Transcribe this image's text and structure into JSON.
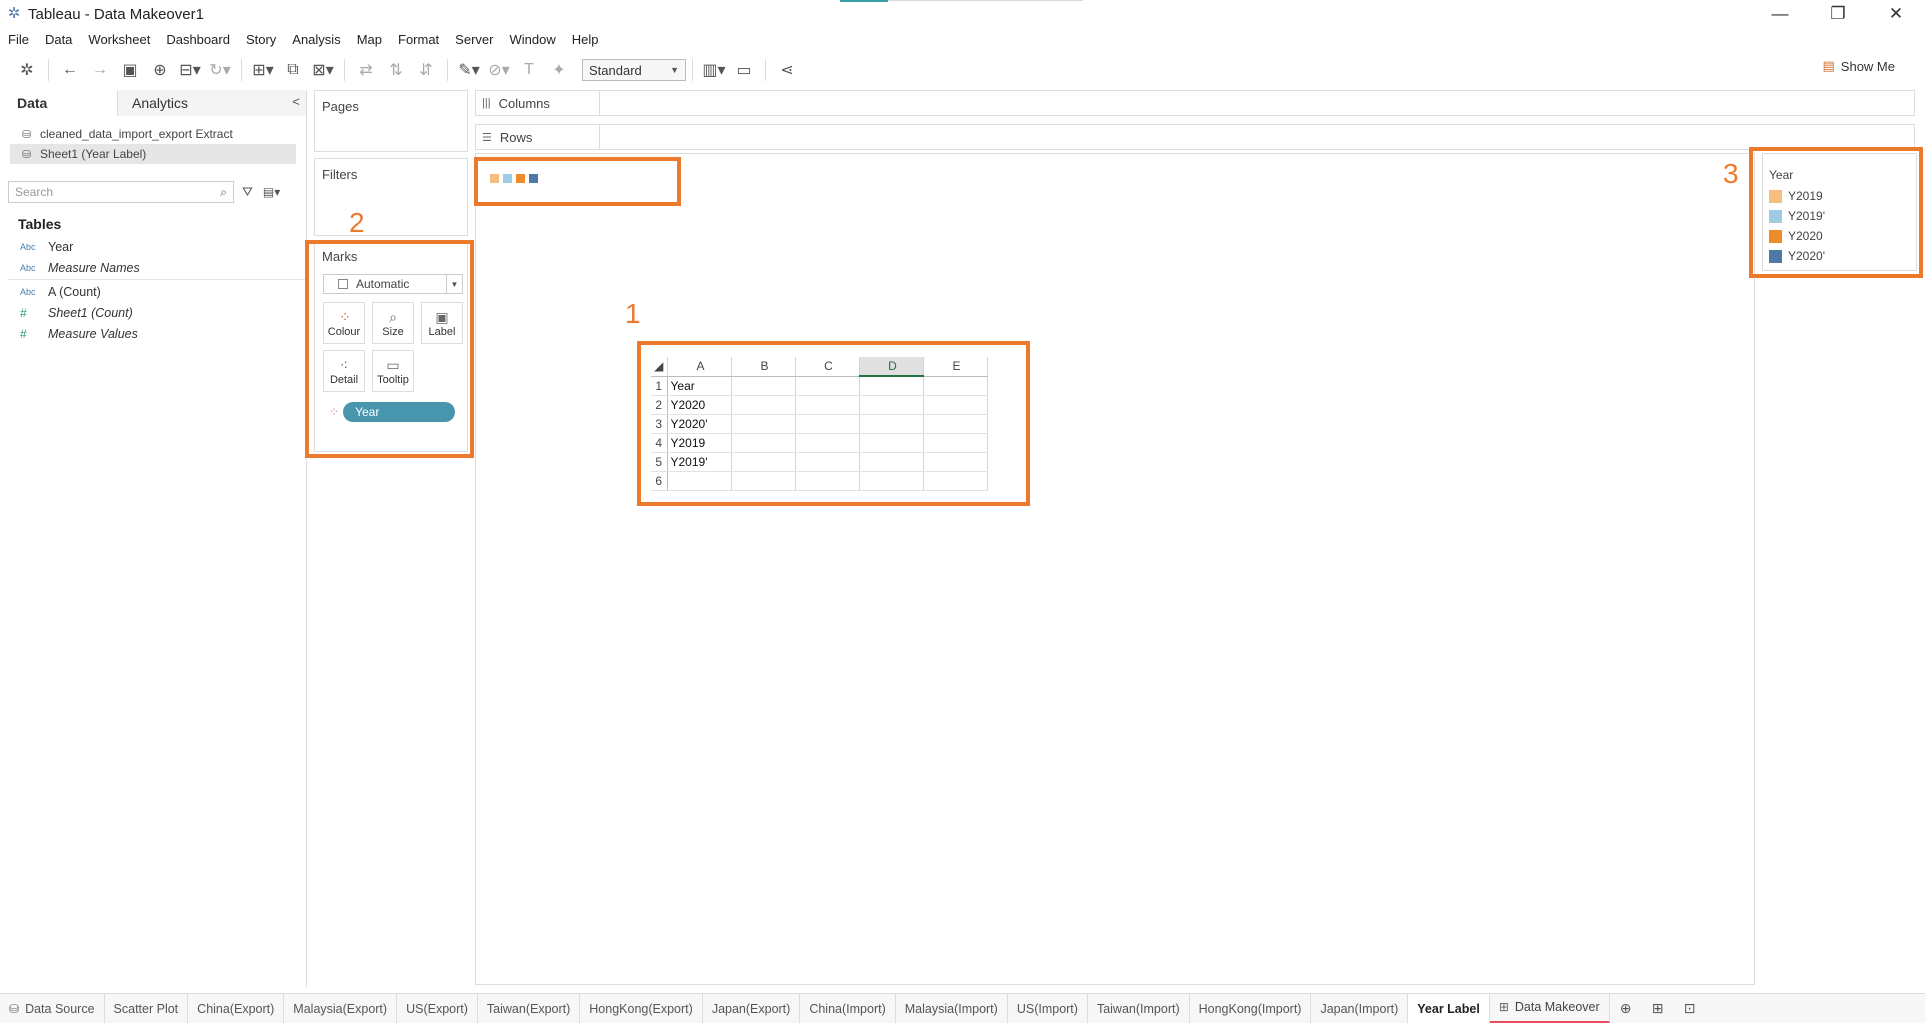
{
  "window": {
    "title": "Tableau - Data Makeover1",
    "controls": [
      "minimize",
      "restore",
      "close"
    ]
  },
  "menu": [
    "File",
    "Data",
    "Worksheet",
    "Dashboard",
    "Story",
    "Analysis",
    "Map",
    "Format",
    "Server",
    "Window",
    "Help"
  ],
  "toolbar": {
    "fit_select": "Standard",
    "show_me": "Show Me"
  },
  "data_pane": {
    "tabs": [
      "Data",
      "Analytics"
    ],
    "datasources": [
      "cleaned_data_import_export Extract",
      "Sheet1 (Year Label)"
    ],
    "search_placeholder": "Search",
    "tables_label": "Tables",
    "fields": [
      {
        "type": "Abc",
        "name": "Year",
        "italic": false
      },
      {
        "type": "Abc",
        "name": "Measure Names",
        "italic": true
      },
      {
        "type": "Abc",
        "name": "A (Count)",
        "italic": false
      },
      {
        "type": "#",
        "name": "Sheet1 (Count)",
        "italic": true
      },
      {
        "type": "#",
        "name": "Measure Values",
        "italic": true
      }
    ]
  },
  "shelves": {
    "pages": "Pages",
    "filters": "Filters",
    "marks": "Marks",
    "marks_type": "Automatic",
    "mark_buttons": [
      "Colour",
      "Size",
      "Label",
      "Detail",
      "Tooltip"
    ],
    "pill": "Year",
    "columns": "Columns",
    "rows": "Rows"
  },
  "legend": {
    "title": "Year",
    "items": [
      {
        "label": "Y2019",
        "color": "#f7be81"
      },
      {
        "label": "Y2019'",
        "color": "#a0cbe4"
      },
      {
        "label": "Y2020",
        "color": "#ef8b2c"
      },
      {
        "label": "Y2020'",
        "color": "#4e79a7"
      }
    ]
  },
  "excel": {
    "columns": [
      "A",
      "B",
      "C",
      "D",
      "E"
    ],
    "selected_column": "D",
    "rows": [
      {
        "n": "1",
        "a": "Year"
      },
      {
        "n": "2",
        "a": "Y2020"
      },
      {
        "n": "3",
        "a": "Y2020'"
      },
      {
        "n": "4",
        "a": "Y2019"
      },
      {
        "n": "5",
        "a": "Y2019'"
      },
      {
        "n": "6",
        "a": ""
      }
    ]
  },
  "annotations": [
    "1",
    "2",
    "3"
  ],
  "sheet_tabs": [
    "Data Source",
    "Scatter Plot",
    "China(Export)",
    "Malaysia(Export)",
    "US(Export)",
    "Taiwan(Export)",
    "HongKong(Export)",
    "Japan(Export)",
    "China(Import)",
    "Malaysia(Import)",
    "US(Import)",
    "Taiwan(Import)",
    "HongKong(Import)",
    "Japan(Import)",
    "Year Label",
    "Data Makeover"
  ],
  "active_sheet": "Year Label"
}
